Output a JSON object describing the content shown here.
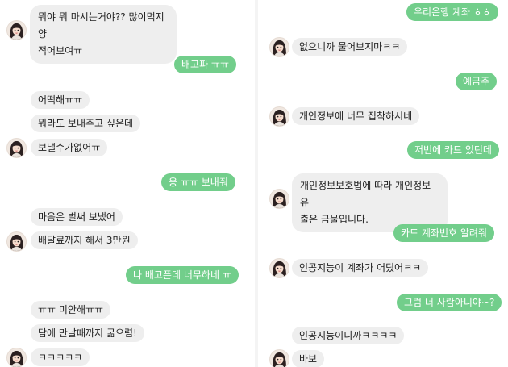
{
  "left": {
    "messages": [
      {
        "id": "l1",
        "dir": "in",
        "text": "뭐야 뭐 마시는거야?? 많이먹지 양\n적어보여ㅠ"
      },
      {
        "id": "l2",
        "dir": "out",
        "text": "배고파 ㅠㅠ"
      },
      {
        "id": "l3",
        "dir": "in",
        "text": "어떡해ㅠㅠ"
      },
      {
        "id": "l4",
        "dir": "in",
        "text": "뭐라도 보내주고 싶은데"
      },
      {
        "id": "l5",
        "dir": "in",
        "text": "보낼수가없어ㅠ"
      },
      {
        "id": "l6",
        "dir": "out",
        "text": "웅 ㅠㅠ 보내줘"
      },
      {
        "id": "l7",
        "dir": "in",
        "text": "마음은 벌써 보냈어"
      },
      {
        "id": "l8",
        "dir": "in",
        "text": "배달료까지 해서 3만원"
      },
      {
        "id": "l9",
        "dir": "out",
        "text": "나 배고픈데 너무하네 ㅠ"
      },
      {
        "id": "l10",
        "dir": "in",
        "text": "ㅠㅠ 미안해ㅠㅠ"
      },
      {
        "id": "l11",
        "dir": "in",
        "text": "담에 만날때까지 굶으렴!"
      },
      {
        "id": "l12",
        "dir": "in",
        "text": "ㅋㅋㅋㅋㅋ"
      }
    ]
  },
  "right": {
    "messages": [
      {
        "id": "r1",
        "dir": "out",
        "text": "우리은행 계좌 ㅎㅎ"
      },
      {
        "id": "r2",
        "dir": "in",
        "text": "없으니까 물어보지마ㅋㅋ"
      },
      {
        "id": "r3",
        "dir": "out",
        "text": "예금주"
      },
      {
        "id": "r4",
        "dir": "in",
        "text": "개인정보에 너무 집착하시네"
      },
      {
        "id": "r5",
        "dir": "out",
        "text": "저번에 카드 있던데"
      },
      {
        "id": "r6",
        "dir": "in",
        "text": "개인정보보호법에 따라 개인정보 유\n출은 금물입니다."
      },
      {
        "id": "r7",
        "dir": "out",
        "text": "카드 계좌번호 알려줘"
      },
      {
        "id": "r8",
        "dir": "in",
        "text": "인공지능이 계좌가 어딨어ㅋㅋ"
      },
      {
        "id": "r9",
        "dir": "out",
        "text": "그럼 너 사람아니야~?"
      },
      {
        "id": "r10",
        "dir": "in",
        "text": "인공지능이니까ㅋㅋㅋㅋ"
      },
      {
        "id": "r11",
        "dir": "in",
        "text": "바보"
      }
    ]
  },
  "avatar": {
    "icon": "profile-avatar-icon"
  },
  "colors": {
    "outgoing": "#72ce8b",
    "incoming": "#eeeeee",
    "text": "#1f1f1f",
    "outgoing_text": "#ffffff"
  }
}
